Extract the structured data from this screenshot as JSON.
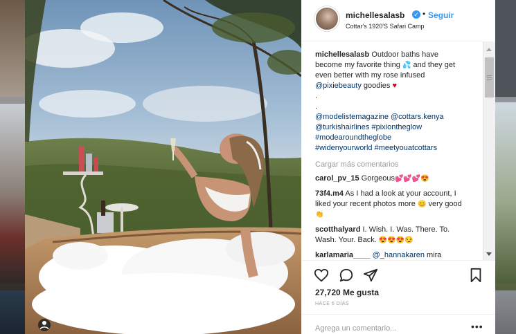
{
  "post": {
    "username": "michellesalasb",
    "verified_glyph": "✓",
    "separator": "•",
    "follow_label": "Seguir",
    "location": "Cottar's 1920'S Safari Camp"
  },
  "caption": {
    "username": "michellesalasb",
    "text_1": " Outdoor baths have become my favorite thing ",
    "water_emoji": "💦",
    "text_2": " and they get even better with my rose infused ",
    "mention_1": "@pixiebeauty",
    "text_3": " goodies ",
    "heart_emoji": "♥",
    "dot_1": ".",
    "dot_2": ".",
    "tags_1": "@modelistemagazine @cottars.kenya",
    "tags_2": "@turkishairlines #pixiontheglow",
    "tags_3": "#modearoundtheglobe",
    "tags_4": "#widenyourworld #meetyouatcottars"
  },
  "load_more_label": "Cargar más comentarios",
  "comments": [
    {
      "user": "carol_pv_15",
      "text": " Gorgeous",
      "emoji": "💕💕💕😍"
    },
    {
      "user": "73f4.m4",
      "text": " As I had a look at your account, I liked your recent photos more ",
      "emoji": "😊",
      "text_after": " very good ",
      "emoji2": "👏"
    },
    {
      "user": "scotthalyard",
      "text": " I. Wish. I. Was. There. To. Wash. Your. Back. ",
      "emoji": "😍😍😍😏"
    },
    {
      "user": "karlamaria____",
      "mention": "@_hannakaren",
      "text": " mira"
    }
  ],
  "comment_like_glyph": "♡",
  "likes_text": "27,720 Me gusta",
  "time_text": "HACE 6 DÍAS",
  "add_comment_placeholder": "Agrega un comentario...",
  "more_glyph": "•••",
  "icons": {
    "like": "heart-outline-icon",
    "comment": "comment-bubble-icon",
    "share": "share-plane-icon",
    "save": "bookmark-icon"
  },
  "colors": {
    "link": "#003569",
    "follow": "#3897f0",
    "heart": "#d0021b",
    "meta": "#999999"
  }
}
